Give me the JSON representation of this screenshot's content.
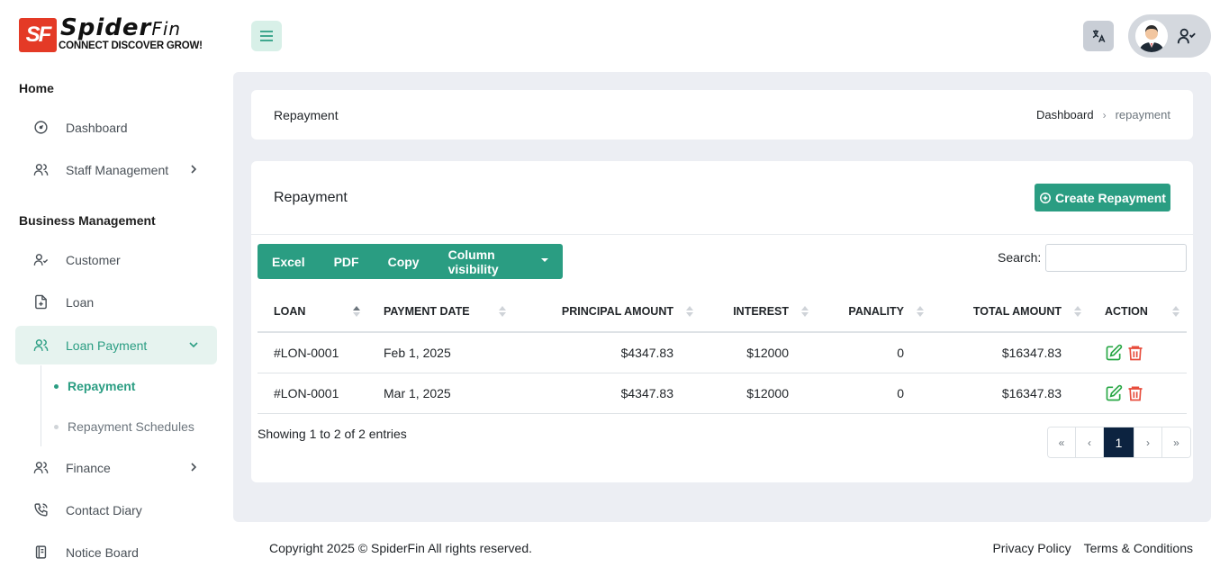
{
  "brand": {
    "logo_mark": "SF",
    "logo_word": "Spider",
    "logo_word_suffix": "Fin",
    "tagline": "CONNECT DISCOVER GROW!"
  },
  "sidebar": {
    "section_home": "Home",
    "section_business": "Business Management",
    "items": {
      "dashboard": "Dashboard",
      "staff": "Staff Management",
      "customer": "Customer",
      "loan": "Loan",
      "loan_payment": "Loan Payment",
      "finance": "Finance",
      "contact_diary": "Contact Diary",
      "notice_board": "Notice Board"
    },
    "sub_items": {
      "repayment": "Repayment",
      "repayment_schedules": "Repayment Schedules"
    }
  },
  "breadcrumb": {
    "title": "Repayment",
    "root": "Dashboard",
    "current": "repayment"
  },
  "card": {
    "title": "Repayment",
    "create_button": "Create Repayment",
    "buttons": {
      "excel": "Excel",
      "pdf": "PDF",
      "copy": "Copy",
      "column_visibility": "Column visibility"
    },
    "search_label": "Search:",
    "search_value": ""
  },
  "table": {
    "headers": {
      "loan": "LOAN",
      "payment_date": "PAYMENT DATE",
      "principal": "PRINCIPAL AMOUNT",
      "interest": "INTEREST",
      "penalty": "PANALITY",
      "total": "TOTAL AMOUNT",
      "action": "ACTION"
    },
    "rows": [
      {
        "loan": "#LON-0001",
        "date": "Feb 1, 2025",
        "principal": "$4347.83",
        "interest": "$12000",
        "penalty": "0",
        "total": "$16347.83"
      },
      {
        "loan": "#LON-0001",
        "date": "Mar 1, 2025",
        "principal": "$4347.83",
        "interest": "$12000",
        "penalty": "0",
        "total": "$16347.83"
      }
    ],
    "info": "Showing 1 to 2 of 2 entries",
    "pager": {
      "first": "«",
      "prev": "‹",
      "current": "1",
      "next": "›",
      "last": "»"
    }
  },
  "footer": {
    "copyright": "Copyright 2025 © SpiderFin All rights reserved.",
    "privacy": "Privacy Policy",
    "terms": "Terms & Conditions"
  },
  "colors": {
    "accent": "#2a9d82",
    "accent_light": "#e6f3ef",
    "brand_red": "#e43a26",
    "pager_active": "#0c2340",
    "edit_icon": "#28a745",
    "delete_icon": "#e74c3c"
  },
  "icons": {
    "menu": "hamburger-icon",
    "translate": "translate-icon",
    "user": "user-check-icon"
  }
}
